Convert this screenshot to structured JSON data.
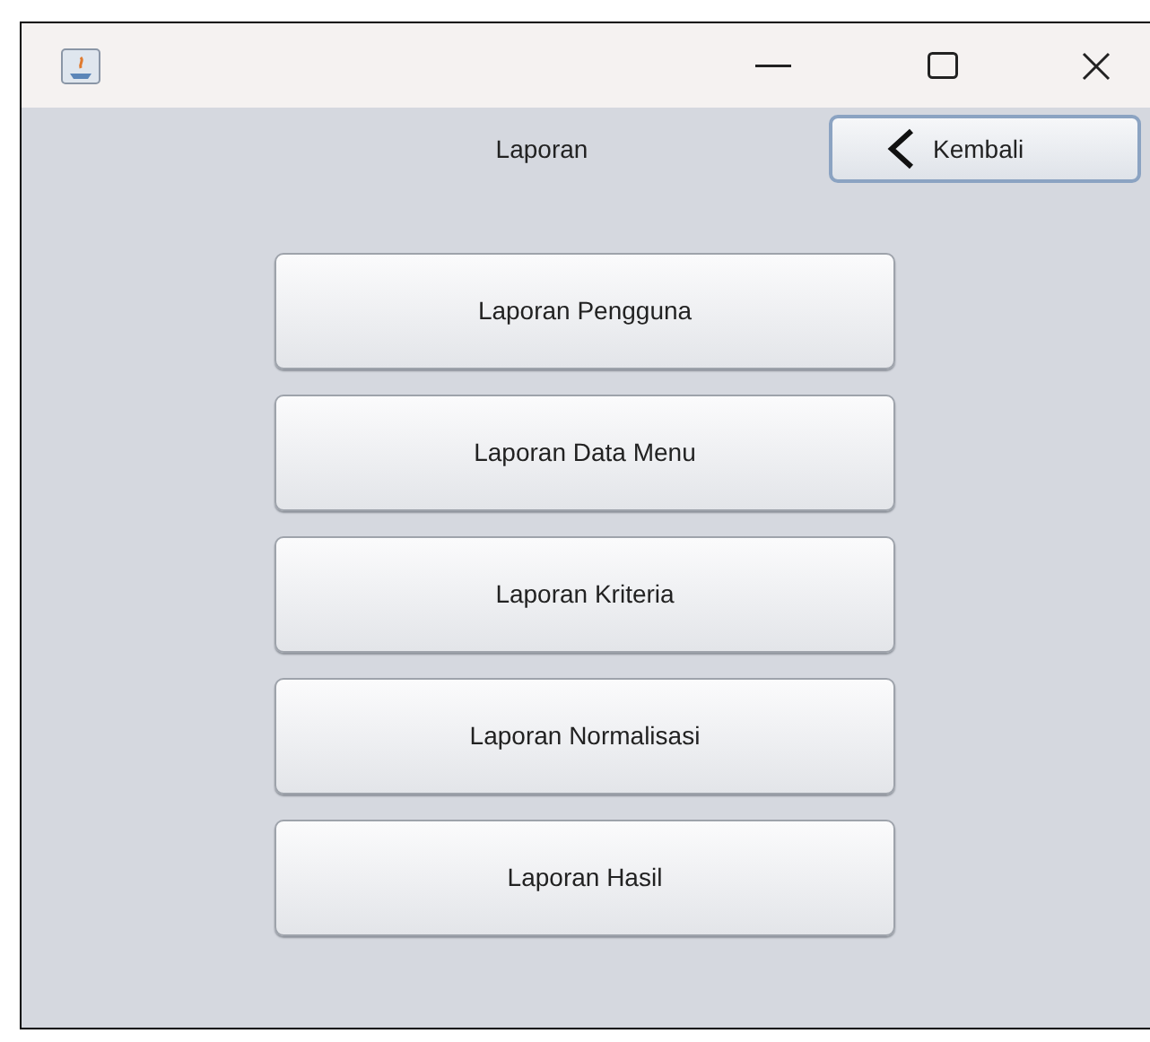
{
  "header": {
    "title": "Laporan",
    "back_button": "Kembali"
  },
  "menu_buttons": [
    "Laporan Pengguna",
    "Laporan Data Menu",
    "Laporan Kriteria",
    "Laporan Normalisasi",
    "Laporan Hasil"
  ]
}
